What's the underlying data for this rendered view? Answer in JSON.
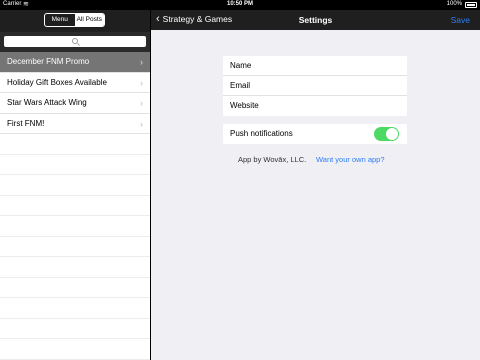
{
  "status_bar": {
    "carrier": "Carrier",
    "time": "10:50 PM",
    "battery": "100%"
  },
  "left": {
    "segment": {
      "menu": "Menu",
      "all_posts": "All Posts"
    },
    "posts": [
      "December FNM Promo",
      "Holiday Gift Boxes Available",
      "Star Wars Attack Wing",
      "First FNM!"
    ]
  },
  "right": {
    "nav": {
      "back": "Strategy & Games",
      "title": "Settings",
      "save": "Save"
    },
    "fields": [
      "Name",
      "Email",
      "Website"
    ],
    "push": {
      "label": "Push notifications",
      "on": true
    },
    "footer": {
      "by": "App by Wovāx, LLC.",
      "link": "Want your own app?"
    }
  },
  "colors": {
    "accent": "#2e7ef6",
    "toggle": "#4cd964",
    "selected_row": "#757575",
    "nav": "#1f1f1f"
  }
}
